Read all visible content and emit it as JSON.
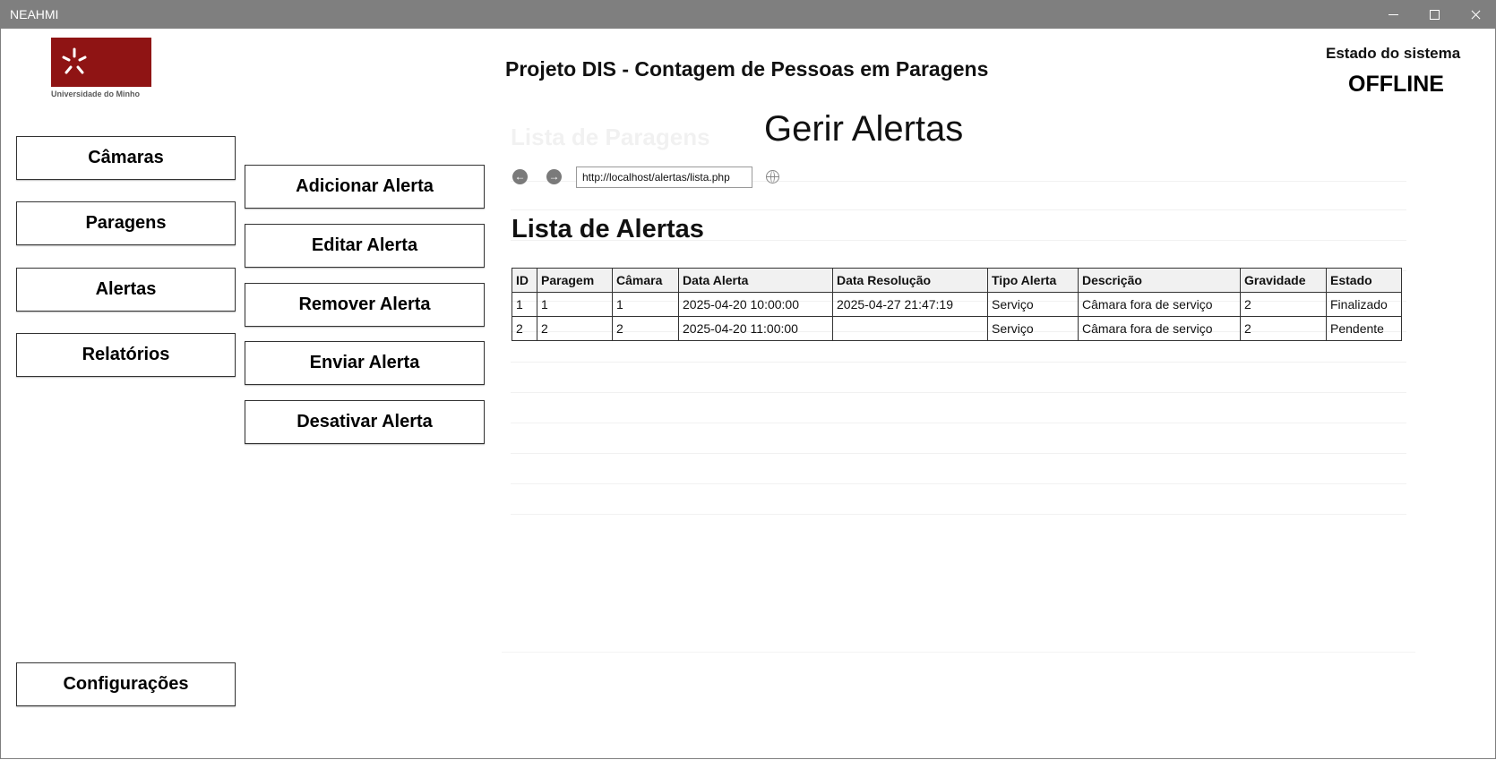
{
  "window": {
    "title": "NEAHMI"
  },
  "header": {
    "logo_caption": "Universidade do Minho",
    "title": "Projeto DIS - Contagem de Pessoas em Paragens",
    "status_label": "Estado do sistema",
    "status_value": "OFFLINE"
  },
  "nav": {
    "cameras": "Câmaras",
    "stops": "Paragens",
    "alerts": "Alertas",
    "reports": "Relatórios",
    "settings": "Configurações"
  },
  "actions": {
    "add": "Adicionar Alerta",
    "edit": "Editar Alerta",
    "remove": "Remover Alerta",
    "send": "Enviar Alerta",
    "disable": "Desativar Alerta"
  },
  "page": {
    "heading": "Gerir Alertas"
  },
  "browser": {
    "url": "http://localhost/alertas/lista.php"
  },
  "content": {
    "list_title": "Lista de Alertas",
    "faded_title": "Lista de Paragens"
  },
  "table": {
    "headers": [
      "ID",
      "Paragem",
      "Câmara",
      "Data Alerta",
      "Data Resolução",
      "Tipo Alerta",
      "Descrição",
      "Gravidade",
      "Estado"
    ],
    "rows": [
      [
        "1",
        "1",
        "1",
        "2025-04-20 10:00:00",
        "2025-04-27 21:47:19",
        "Serviço",
        "Câmara fora de serviço",
        "2",
        "Finalizado"
      ],
      [
        "2",
        "2",
        "2",
        "2025-04-20 11:00:00",
        "",
        "Serviço",
        "Câmara fora de serviço",
        "2",
        "Pendente"
      ]
    ]
  },
  "colors": {
    "titlebar": "#7f7f7f",
    "brand": "#8f1414"
  },
  "icons": [
    "minimize-icon",
    "maximize-icon",
    "close-icon",
    "logo-icon",
    "back-arrow-icon",
    "forward-arrow-icon",
    "globe-icon"
  ]
}
